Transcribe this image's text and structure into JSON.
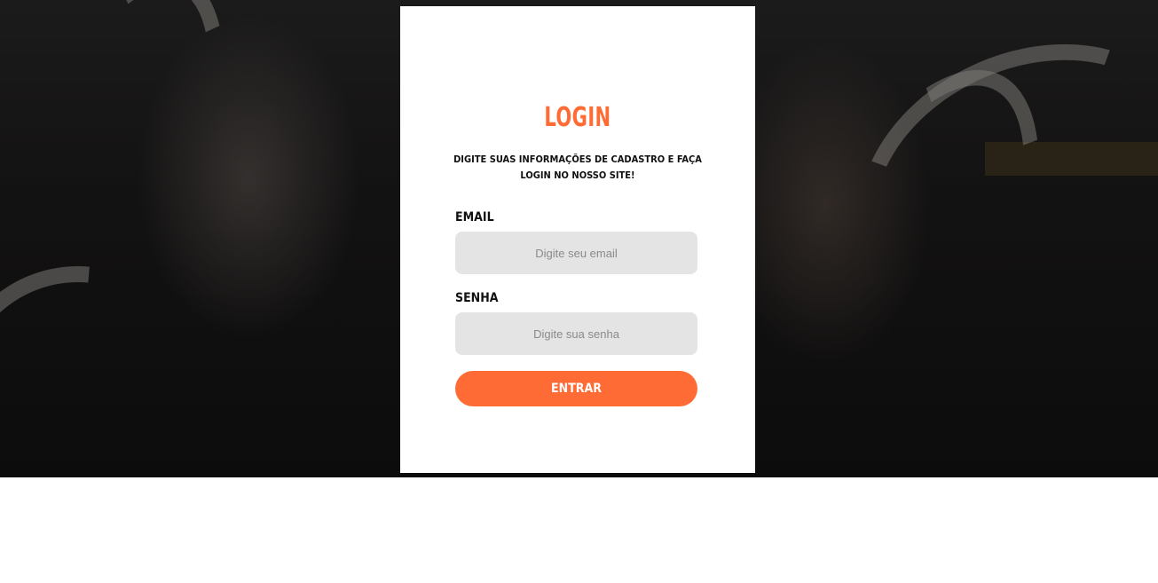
{
  "login": {
    "title": "LOGIN",
    "subtitle": "DIGITE SUAS INFORMAÇÕES DE CADASTRO E FAÇA LOGIN NO NOSSO SITE!",
    "email_label": "EMAIL",
    "email_placeholder": "Digite seu email",
    "email_value": "",
    "password_label": "SENHA",
    "password_placeholder": "Digite sua senha",
    "password_value": "",
    "submit_label": "ENTRAR"
  },
  "colors": {
    "accent": "#ff6b35",
    "input_bg": "#e4e4e4",
    "card_bg": "#ffffff"
  }
}
